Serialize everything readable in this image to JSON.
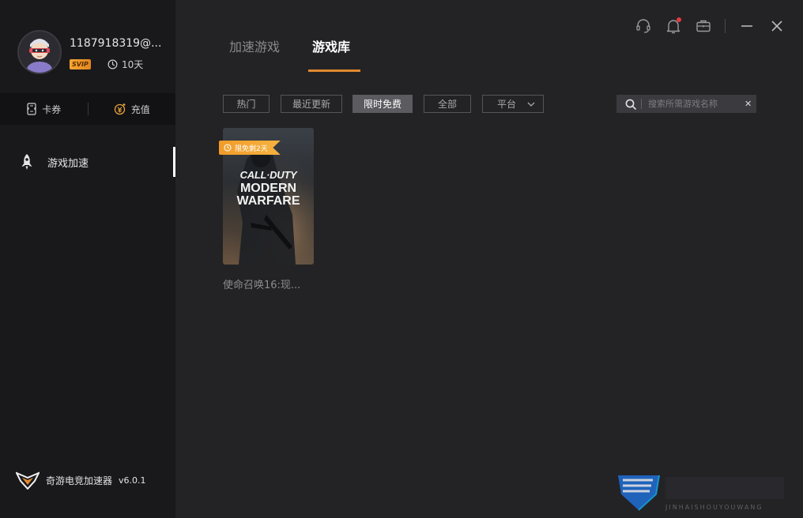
{
  "user": {
    "name": "1187918319@...",
    "badge": "SVIP",
    "days": "10天"
  },
  "wallet": {
    "coupon_label": "卡券",
    "recharge_label": "充值"
  },
  "nav": {
    "items": [
      {
        "label": "游戏加速",
        "icon": "rocket-icon",
        "active": true
      }
    ]
  },
  "brand": {
    "name": "奇游电竞加速器",
    "version": "v6.0.1"
  },
  "tabs": [
    {
      "label": "加速游戏",
      "active": false
    },
    {
      "label": "游戏库",
      "active": true
    }
  ],
  "window_controls": [
    "headset-icon",
    "bell-icon",
    "briefcase-icon",
    "minimize-icon",
    "close-icon"
  ],
  "notification_dot": true,
  "filters": [
    {
      "label": "热门",
      "active": false
    },
    {
      "label": "最近更新",
      "active": false
    },
    {
      "label": "限时免费",
      "active": true
    },
    {
      "label": "全部",
      "active": false
    },
    {
      "label": "平台",
      "active": false,
      "dropdown": true
    }
  ],
  "search": {
    "placeholder": "搜索所需游戏名称",
    "value": ""
  },
  "games": [
    {
      "title": "使命召唤16:现...",
      "tag": "限免剩2天",
      "cover_lines": [
        "CALL·DUTY",
        "MODERN",
        "WARFARE"
      ]
    }
  ],
  "colors": {
    "accent": "#e08a2e",
    "sidebar_bg": "#19191c",
    "main_bg": "#232326",
    "active_filter_bg": "#5b5b60",
    "tag_orange": "#f29b28",
    "notification_red": "#e33b3b"
  }
}
